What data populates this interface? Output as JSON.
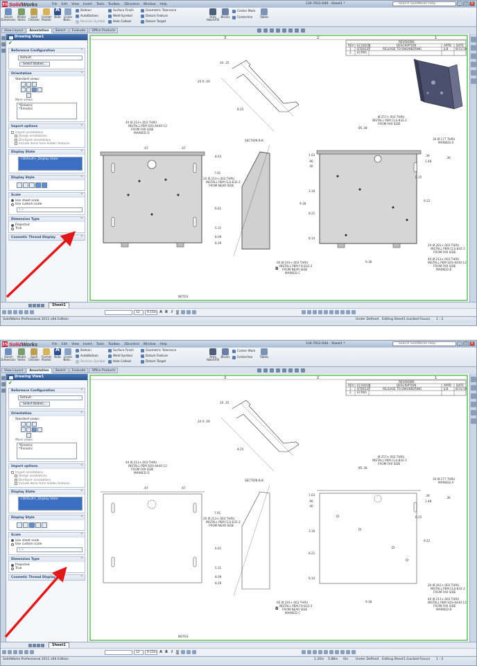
{
  "app": {
    "brand_main": "Solid",
    "brand_rest": "Works",
    "menus": [
      "File",
      "Edit",
      "View",
      "Insert",
      "Tools",
      "Toolbox",
      "3Dcontrol",
      "Window",
      "Help"
    ],
    "doc_title_1": "130-7912-D46 - Sheet1 *",
    "doc_title_2": "130-7912-D46 - Sheet1 *",
    "help_search_placeholder": "Search SolidWorks Help"
  },
  "ribbon": {
    "smart_dimension": "Smart Dimension",
    "model_items": "Model Items",
    "spell_checker": "Spell Checker",
    "format_painter": "Format Painter",
    "note": "Note",
    "linear_note_pattern": "Linear Note...",
    "balloon": "Balloon",
    "auto_balloon": "AutoBalloon",
    "revision_symbol": "Revision Symbol",
    "surface_finish": "Surface Finish",
    "weld_symbol": "Weld Symbol",
    "hole_callout": "Hole Callout",
    "geometric_tolerance": "Geometric Tolerance",
    "datum_feature": "Datum Feature",
    "datum_target": "Datum Target",
    "area_hatch": "Area Hatch/Fill",
    "blocks": "Blocks",
    "center_mark": "Center Mark",
    "centerline": "Centerline",
    "tables": "Tables"
  },
  "tabs": [
    "View Layout",
    "Annotation",
    "Sketch",
    "Evaluate",
    "Office Products"
  ],
  "property_manager": {
    "title": "Drawing View1",
    "reference_configuration": "Reference Configuration",
    "config_value": "Default",
    "select_bodies": "Select Bodies...",
    "orientation": "Orientation",
    "standard_views": "Standard views:",
    "more_views": "More views:",
    "more_views_items": [
      "*Dimetric",
      "*Trimetric"
    ],
    "import_options": "Import options",
    "import_items": [
      "Import annotations",
      "Design annotations",
      "DimXpert annotations",
      "Include items from hidden features"
    ],
    "display_state": "Display State",
    "display_state_value": "<Default>_Display State",
    "display_style": "Display Style",
    "scale": "Scale",
    "scale_use_sheet": "Use sheet scale",
    "scale_use_custom": "Use custom scale",
    "scale_value": "1:2",
    "dimension_type": "Dimension Type",
    "dim_projected": "Projected",
    "dim_true": "True",
    "cosmetic_thread": "Cosmetic Thread Display"
  },
  "drawing": {
    "zones": [
      "3",
      "2",
      "1"
    ],
    "revisions_title": "REVISIONS",
    "rev_headers": [
      "REV",
      "ECO/DCN",
      "DESCRIPTION",
      "APPD",
      "DATE"
    ],
    "rev_rows": [
      [
        "1",
        "DT66127",
        "RELEASE TO ENGINEERING",
        "JLB",
        "8/31/10"
      ],
      [
        "2",
        "ECRN1",
        "",
        "",
        ""
      ]
    ],
    "dims_top": [
      "2X .25",
      "2X R .09",
      "8.25",
      "SECTION B-B"
    ],
    "note_left_1": "4X Ø.213+.003 THRU",
    "note_left_2": "INSTALL PEM SOS-6440-12",
    "note_left_3": "FROM FAR SIDE",
    "note_left_4": "MARKED D",
    "note_mid_1": "2X Ø.213+.003 THRU",
    "note_mid_2": "INSTALL PEM CLS-632-2",
    "note_mid_3": "FROM NEAR SIDE",
    "note_r1_1": "Ø.257+.003 THRU",
    "note_r1_2": "INSTALL PEM CLS-832-2",
    "note_r1_3": "FROM FAR SIDE",
    "note_r2_1": "3X Ø.177 THRU",
    "note_r2_2": "MARKED A",
    "note_r3_1": "2X Ø.281+.003 THRU",
    "note_r3_2": "INSTALL PEM CLS-832-2",
    "note_r3_3": "FROM FAR SIDE",
    "note_r4_1": "4X Ø.213+.003 THRU",
    "note_r4_2": "INSTALL PEM SOS-6440-12",
    "note_r4_3": "FROM FAR SIDE",
    "note_r4_4": "MARKED B",
    "note_b_1": "6X Ø.193+.003 THRU",
    "note_b_2": "INSTALL PEM FH-832-2",
    "note_b_3": "FROM NEAR SIDE",
    "note_b_4": "MARKED C",
    "notes_label": "NOTES:",
    "dims_misc": [
      ".67",
      ".67",
      "10.84",
      "7.91",
      "8.63",
      "6.61",
      "5.31",
      "8.09",
      "8.29",
      "6.00",
      "8.06",
      "1.63",
      ".40",
      ".96",
      ".39",
      "1.48",
      "R.25",
      "8.14",
      "8.21",
      "9.38",
      "9.22",
      "Ø1.38",
      "5.93",
      "3.16",
      "8.01",
      ".36"
    ],
    "section_label": "B"
  },
  "sheet": {
    "tab": "Sheet1"
  },
  "format_bar": {
    "font_size": "12",
    "font_size2": "9.15in"
  },
  "status": {
    "edition": "SolidWorks Professional 2011 x64 Edition",
    "coord_x": "1.20in",
    "coord_y": "5.88in",
    "coord_z": "0in",
    "state": "Under Defined",
    "editing": "Editing Sheet1 (Locked Focus)",
    "scale": "1 : 2"
  },
  "colors": {
    "brand": "#c8102e",
    "accent": "#2d5590",
    "sheet_border": "#00a000",
    "arrow": "#e01818"
  }
}
